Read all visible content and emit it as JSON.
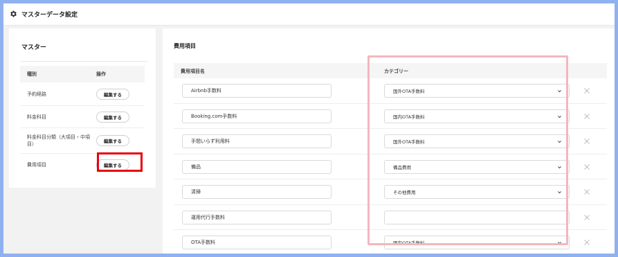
{
  "header": {
    "title": "マスターデータ設定",
    "icon": "gear-icon"
  },
  "master": {
    "heading": "マスター",
    "columns": {
      "type": "種別",
      "action": "操作"
    },
    "rows": [
      {
        "label": "予約経路",
        "button": "編集する"
      },
      {
        "label": "料金科目",
        "button": "編集する"
      },
      {
        "label": "料金科目分類（大項目・中項目）",
        "button": "編集する"
      },
      {
        "label": "費用項目",
        "button": "編集する"
      }
    ]
  },
  "expense": {
    "heading": "費用項目",
    "columns": {
      "name": "費用項目名",
      "category": "カテゴリー"
    },
    "rows": [
      {
        "name": "Airbnb手数料",
        "category": "国外OTA手数料"
      },
      {
        "name": "Booking.com手数料",
        "category": "国内OTA手数料"
      },
      {
        "name": "手間いらず利用料",
        "category": "国外OTA手数料"
      },
      {
        "name": "備品",
        "category": "備品費用"
      },
      {
        "name": "清掃",
        "category": "その他費用"
      },
      {
        "name": "運用代行手数料",
        "category": ""
      },
      {
        "name": "OTA手数料",
        "category": "国内OTA手数料"
      }
    ]
  },
  "colors": {
    "background_frame": "#8fb1ef",
    "highlight_category": "#f4b6be",
    "highlight_button": "#e8000b"
  }
}
